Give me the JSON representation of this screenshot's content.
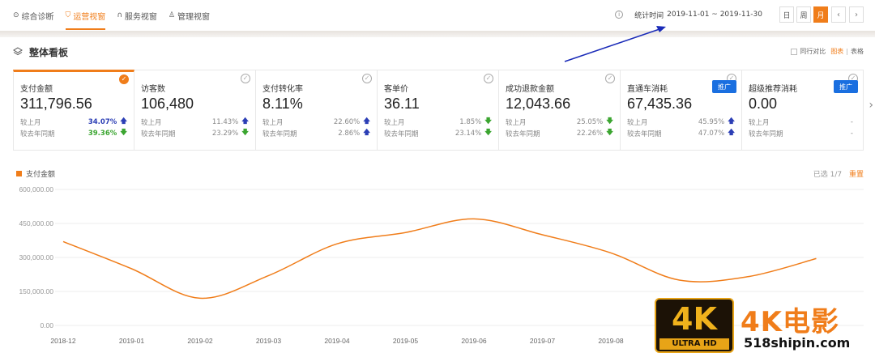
{
  "nav": {
    "tabs": [
      {
        "label": "综合诊断",
        "icon": "pin-icon",
        "active": false
      },
      {
        "label": "运营视窗",
        "icon": "shield-icon",
        "active": true
      },
      {
        "label": "服务视窗",
        "icon": "headset-icon",
        "active": false
      },
      {
        "label": "管理视窗",
        "icon": "person-icon",
        "active": false
      }
    ],
    "stat_label": "统计时间",
    "stat_range": "2019-11-01 ~ 2019-11-30",
    "period_buttons": [
      "日",
      "周",
      "月"
    ],
    "active_period": "月",
    "prev": "‹",
    "next": "›"
  },
  "section": {
    "title": "整体看板",
    "compare_label": "同行对比",
    "view_chart": "图表",
    "view_table": "表格",
    "separator": "|"
  },
  "cards": [
    {
      "title": "支付金额",
      "value": "311,796.56",
      "mom_label": "较上月",
      "mom": "34.07%",
      "mom_dir": "up",
      "yoy_label": "较去年同期",
      "yoy": "39.36%",
      "yoy_dir": "down",
      "selected": true,
      "promo": ""
    },
    {
      "title": "访客数",
      "value": "106,480",
      "mom_label": "较上月",
      "mom": "11.43%",
      "mom_dir": "up",
      "yoy_label": "较去年同期",
      "yoy": "23.29%",
      "yoy_dir": "down",
      "selected": false,
      "promo": ""
    },
    {
      "title": "支付转化率",
      "value": "8.11%",
      "mom_label": "较上月",
      "mom": "22.60%",
      "mom_dir": "up",
      "yoy_label": "较去年同期",
      "yoy": "2.86%",
      "yoy_dir": "up",
      "selected": false,
      "promo": ""
    },
    {
      "title": "客单价",
      "value": "36.11",
      "mom_label": "较上月",
      "mom": "1.85%",
      "mom_dir": "down",
      "yoy_label": "较去年同期",
      "yoy": "23.14%",
      "yoy_dir": "down",
      "selected": false,
      "promo": ""
    },
    {
      "title": "成功退款金额",
      "value": "12,043.66",
      "mom_label": "较上月",
      "mom": "25.05%",
      "mom_dir": "down",
      "yoy_label": "较去年同期",
      "yoy": "22.26%",
      "yoy_dir": "down",
      "selected": false,
      "promo": ""
    },
    {
      "title": "直通车消耗",
      "value": "67,435.36",
      "mom_label": "较上月",
      "mom": "45.95%",
      "mom_dir": "up",
      "yoy_label": "较去年同期",
      "yoy": "47.07%",
      "yoy_dir": "up",
      "selected": false,
      "promo": "推广"
    },
    {
      "title": "超级推荐消耗",
      "value": "0.00",
      "mom_label": "较上月",
      "mom": "-",
      "mom_dir": "",
      "yoy_label": "较去年同期",
      "yoy": "-",
      "yoy_dir": "",
      "selected": false,
      "promo": "推广"
    }
  ],
  "chart": {
    "legend": "支付金额",
    "selected_count": "已选 1/7",
    "reset": "重置",
    "accent": "#f07d1a"
  },
  "chart_data": {
    "type": "line",
    "series": [
      {
        "name": "支付金额",
        "x": [
          "2018-12",
          "2019-01",
          "2019-02",
          "2019-03",
          "2019-04",
          "2019-05",
          "2019-06",
          "2019-07",
          "2019-08",
          "2019-09",
          "2019-10",
          "2019-11"
        ],
        "values": [
          370000,
          250000,
          120000,
          220000,
          360000,
          410000,
          470000,
          400000,
          320000,
          200000,
          215000,
          295000
        ]
      }
    ],
    "x_ticks": [
      "2018-12",
      "2019-01",
      "2019-02",
      "2019-03",
      "2019-04",
      "2019-05",
      "2019-06",
      "2019-07",
      "2019-08"
    ],
    "y_ticks": [
      "0.00",
      "150,000.00",
      "300,000.00",
      "450,000.00",
      "600,000.00"
    ],
    "ylim": [
      0,
      600000
    ]
  },
  "watermark": {
    "logo_text": "4K",
    "logo_sub": "ULTRA HD",
    "title": "4K电影",
    "url": "518shipin.com"
  },
  "colors": {
    "accent": "#f07d1a",
    "up": "#2b3eb5",
    "down": "#3ba530",
    "promo": "#1a6fe0",
    "annotation_arrow": "#1a2bb8"
  }
}
